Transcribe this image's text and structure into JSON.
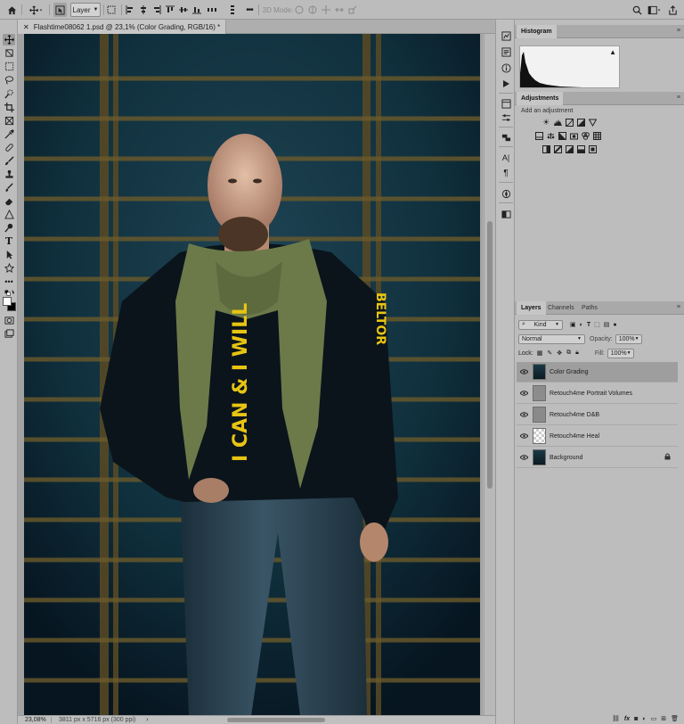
{
  "options_bar": {
    "auto_select_target": "Layer",
    "mode_3d_label": "3D Mode:"
  },
  "document": {
    "tab_title": "Flashtime08062 1.psd @ 23,1% (Color Grading, RGB/16) *",
    "zoom": "23,08%",
    "doc_info": "3811 px x 5716 px (300 ppi)"
  },
  "photo": {
    "hoodie_text_chest": "I CAN & I WILL",
    "hoodie_text_sleeve": "BELTOR"
  },
  "histogram_panel": {
    "tab": "Histogram"
  },
  "adjustments_panel": {
    "tab": "Adjustments",
    "prompt": "Add an adjustment"
  },
  "layers_panel": {
    "tabs": [
      "Layers",
      "Channels",
      "Paths"
    ],
    "filter_kind": "Kind",
    "blend_mode": "Normal",
    "opacity_label": "Opacity:",
    "opacity_value": "100%",
    "lock_label": "Lock:",
    "fill_label": "Fill:",
    "fill_value": "100%",
    "layers": [
      {
        "name": "Color Grading",
        "selected": true
      },
      {
        "name": "Retouch4me Portrait Volumes",
        "selected": false
      },
      {
        "name": "Retouch4me D&B",
        "selected": false
      },
      {
        "name": "Retouch4me Heal",
        "selected": false
      },
      {
        "name": "Background",
        "selected": false,
        "locked": true
      }
    ],
    "footer_icons": [
      "link-icon",
      "fx-icon",
      "mask-icon",
      "adjustment-layer-icon",
      "group-icon",
      "new-layer-icon",
      "trash-icon"
    ]
  },
  "colors": {
    "app_bg": "#b4b4b4",
    "panel_bg": "#bdbdbd",
    "selected_layer": "#9e9e9e",
    "photo_bg": "#0d2430",
    "scarf": "#6c7a4a",
    "hoodie_text": "#e8c412"
  }
}
